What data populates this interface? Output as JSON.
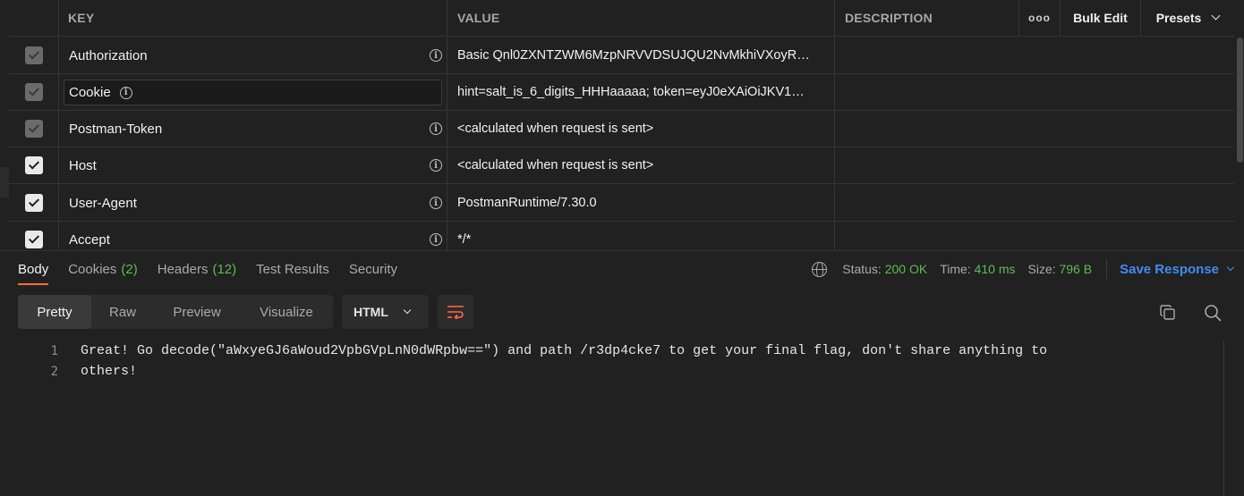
{
  "table": {
    "headers": {
      "key": "KEY",
      "value": "VALUE",
      "description": "DESCRIPTION",
      "more": "ooo",
      "bulk_edit": "Bulk Edit",
      "presets": "Presets"
    },
    "rows": [
      {
        "key": "Authorization",
        "value": "Basic Qnl0ZXNTZWM6MzpNRVVDSUJQU2NvMkhiVXoyR…",
        "checked": true,
        "disabled": true
      },
      {
        "key": "Cookie",
        "value": "hint=salt_is_6_digits_HHHaaaaa; token=eyJ0eXAiOiJKV1…",
        "checked": true,
        "disabled": true
      },
      {
        "key": "Postman-Token",
        "value": "<calculated when request is sent>",
        "checked": true,
        "disabled": true
      },
      {
        "key": "Host",
        "value": "<calculated when request is sent>",
        "checked": true,
        "disabled": false
      },
      {
        "key": "User-Agent",
        "value": "PostmanRuntime/7.30.0",
        "checked": true,
        "disabled": false
      },
      {
        "key": "Accept",
        "value": "*/*",
        "checked": true,
        "disabled": false
      }
    ]
  },
  "response": {
    "tabs": [
      {
        "label": "Body",
        "badge": ""
      },
      {
        "label": "Cookies",
        "badge": "(2)"
      },
      {
        "label": "Headers",
        "badge": "(12)"
      },
      {
        "label": "Test Results",
        "badge": ""
      },
      {
        "label": "Security",
        "badge": ""
      }
    ],
    "status_label": "Status:",
    "status_value": "200 OK",
    "time_label": "Time:",
    "time_value": "410 ms",
    "size_label": "Size:",
    "size_value": "796 B",
    "save_label": "Save Response",
    "views": [
      "Pretty",
      "Raw",
      "Preview",
      "Visualize"
    ],
    "format": "HTML",
    "lines": [
      {
        "n": "1",
        "text": "Great! Go decode(\"aWxyeGJ6aWoud2VpbGVpLnN0dWRpbw==\") and path /r3dp4cke7 to get your final flag, don't share anything to"
      },
      {
        "n": "2",
        "text": "others!"
      }
    ]
  },
  "colors": {
    "accent": "#ff6c37",
    "success": "#5fb955",
    "link": "#3d8cf5"
  }
}
